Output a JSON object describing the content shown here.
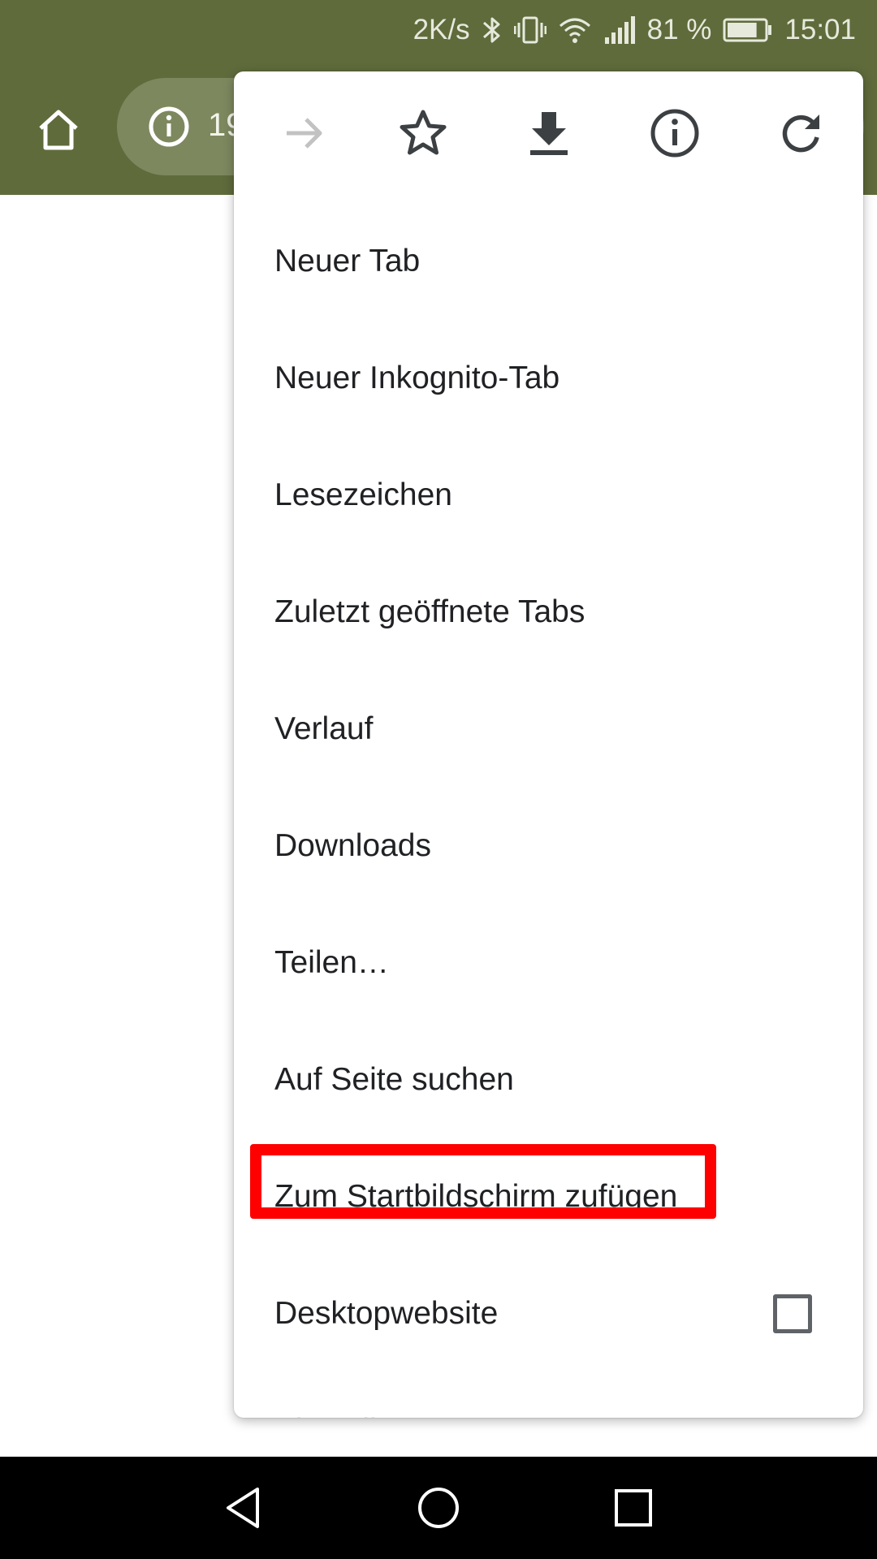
{
  "status_bar": {
    "network_speed": "2K/s",
    "battery_percent": "81 %",
    "battery_level": 0.81,
    "time": "15:01",
    "icons": [
      "bluetooth-icon",
      "vibrate-icon",
      "wifi-icon",
      "signal-icon",
      "battery-icon"
    ]
  },
  "toolbar": {
    "url_text": "19",
    "icons": [
      "home-icon",
      "info-icon"
    ]
  },
  "menu": {
    "icon_row": [
      "forward-arrow-icon",
      "bookmark-star-icon",
      "download-icon",
      "page-info-icon",
      "reload-icon"
    ],
    "items": [
      {
        "label": "Neuer Tab"
      },
      {
        "label": "Neuer Inkognito-Tab"
      },
      {
        "label": "Lesezeichen"
      },
      {
        "label": "Zuletzt geöffnete Tabs"
      },
      {
        "label": "Verlauf"
      },
      {
        "label": "Downloads"
      },
      {
        "label": "Teilen…"
      },
      {
        "label": "Auf Seite suchen"
      },
      {
        "label": "Zum Startbildschirm zufügen"
      },
      {
        "label": "Desktopwebsite",
        "checked": false
      },
      {
        "label": "Einstellungen"
      }
    ],
    "highlight_color": "#ff0000"
  },
  "nav_bar": {
    "icons": [
      "back-icon",
      "home-circle-icon",
      "recents-icon"
    ]
  },
  "colors": {
    "toolbar": "#5f6b3b",
    "omnibox": "#7e885f",
    "nav_bar": "#000000"
  }
}
